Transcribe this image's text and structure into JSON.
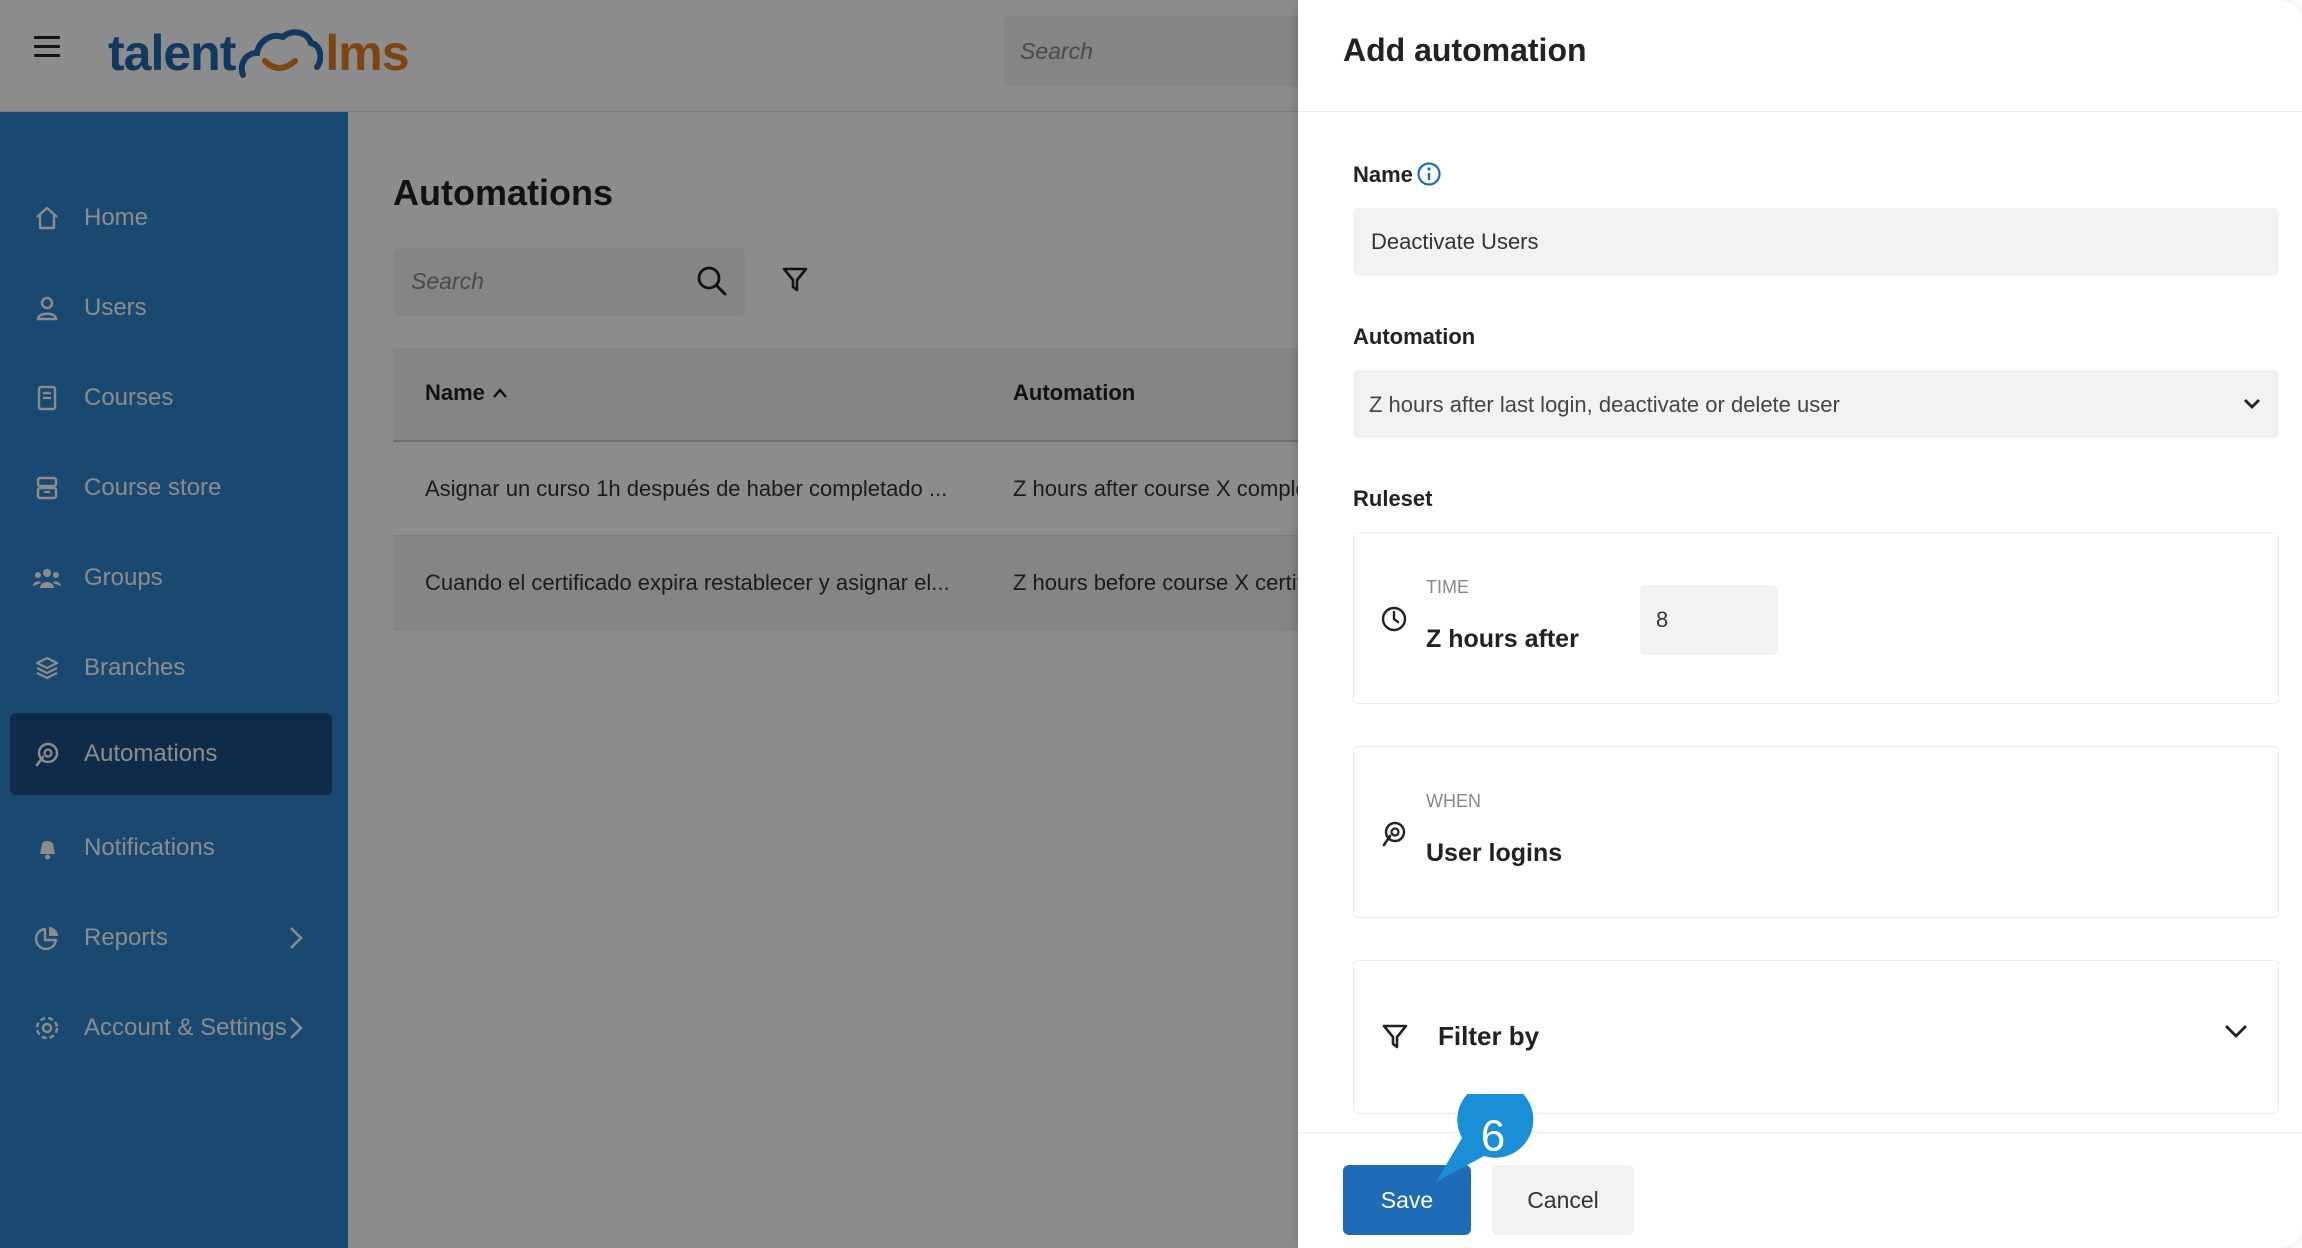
{
  "topbar": {
    "logo_left": "talent",
    "logo_right": "lms",
    "search_placeholder": "Search"
  },
  "sidebar": {
    "items": [
      {
        "label": "Home",
        "icon": "home-icon"
      },
      {
        "label": "Users",
        "icon": "user-icon"
      },
      {
        "label": "Courses",
        "icon": "course-icon"
      },
      {
        "label": "Course store",
        "icon": "store-icon"
      },
      {
        "label": "Groups",
        "icon": "groups-icon"
      },
      {
        "label": "Branches",
        "icon": "branches-icon"
      },
      {
        "label": "Automations",
        "icon": "automation-icon",
        "active": true
      },
      {
        "label": "Notifications",
        "icon": "notification-icon"
      },
      {
        "label": "Reports",
        "icon": "reports-icon",
        "has_submenu": true
      },
      {
        "label": "Account & Settings",
        "icon": "settings-icon",
        "has_submenu": true
      }
    ]
  },
  "main": {
    "title": "Automations",
    "search_placeholder": "Search",
    "table": {
      "headers": {
        "name": "Name",
        "automation": "Automation"
      },
      "rows": [
        {
          "name": "Asignar un curso 1h después de haber completado ...",
          "automation": "Z hours after course X completion"
        },
        {
          "name": "Cuando el certificado expira restablecer y asignar el...",
          "automation": "Z hours before course X certificate"
        }
      ]
    }
  },
  "drawer": {
    "title": "Add automation",
    "name_label": "Name",
    "name_value": "Deactivate Users",
    "automation_label": "Automation",
    "automation_value": "Z hours after last login, deactivate or delete user",
    "ruleset_label": "Ruleset",
    "time_tag": "TIME",
    "time_value": "Z hours after",
    "hours_value": "8",
    "when_tag": "WHEN",
    "when_value": "User logins",
    "filter_label": "Filter by",
    "save_label": "Save",
    "cancel_label": "Cancel"
  },
  "step_badge": {
    "number": "6",
    "color": "#1a8fd6"
  },
  "colors": {
    "sidebar": "#2f83ce",
    "sidebar_active": "#1a4f85",
    "primary_button": "#1e6bb8",
    "logo_blue": "#1e66b0",
    "logo_orange": "#e67e22"
  }
}
